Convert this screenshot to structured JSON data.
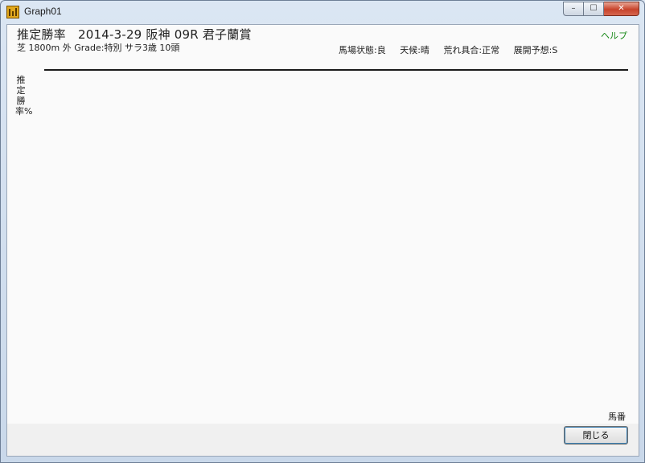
{
  "window": {
    "title": "Graph01",
    "minimize_glyph": "–",
    "maximize_glyph": "☐",
    "close_glyph": "✕"
  },
  "header": {
    "title": "推定勝率　2014-3-29 阪神 09R 君子蘭賞",
    "subtitle": "芝 1800m 外 Grade:特別 サラ3歳 10頭",
    "help_label": "ヘルプ",
    "conditions": [
      "馬場状態:良",
      "天候:晴",
      "荒れ具合:正常",
      "展開予想:S"
    ]
  },
  "chart": {
    "y_label": "推定勝率%",
    "x_label": "馬番"
  },
  "footer": {
    "close_label": "閉じる"
  },
  "colors": {
    "help_link": "#1a8a1a",
    "close_accent": "#c7432b"
  }
}
